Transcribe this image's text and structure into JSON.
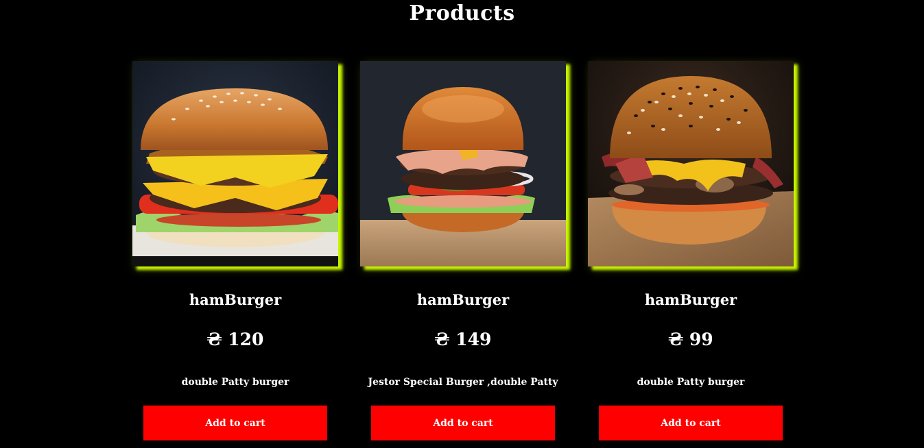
{
  "page": {
    "title": "Products"
  },
  "products": [
    {
      "name": "hamBurger",
      "price": "₴ 120",
      "description": "double Patty burger",
      "button_label": "Add to cart",
      "image_label": "burger-photo"
    },
    {
      "name": "hamBurger",
      "price": "₴ 149",
      "description": "Jestor Special Burger ,double Patty",
      "button_label": "Add to cart",
      "image_label": "burger-photo"
    },
    {
      "name": "hamBurger",
      "price": "₴ 99",
      "description": "double Patty burger",
      "button_label": "Add to cart",
      "image_label": "burger-photo"
    }
  ],
  "colors": {
    "background": "#000000",
    "button": "#ff0000",
    "glow": "#c7f500",
    "text": "#ffffff"
  }
}
